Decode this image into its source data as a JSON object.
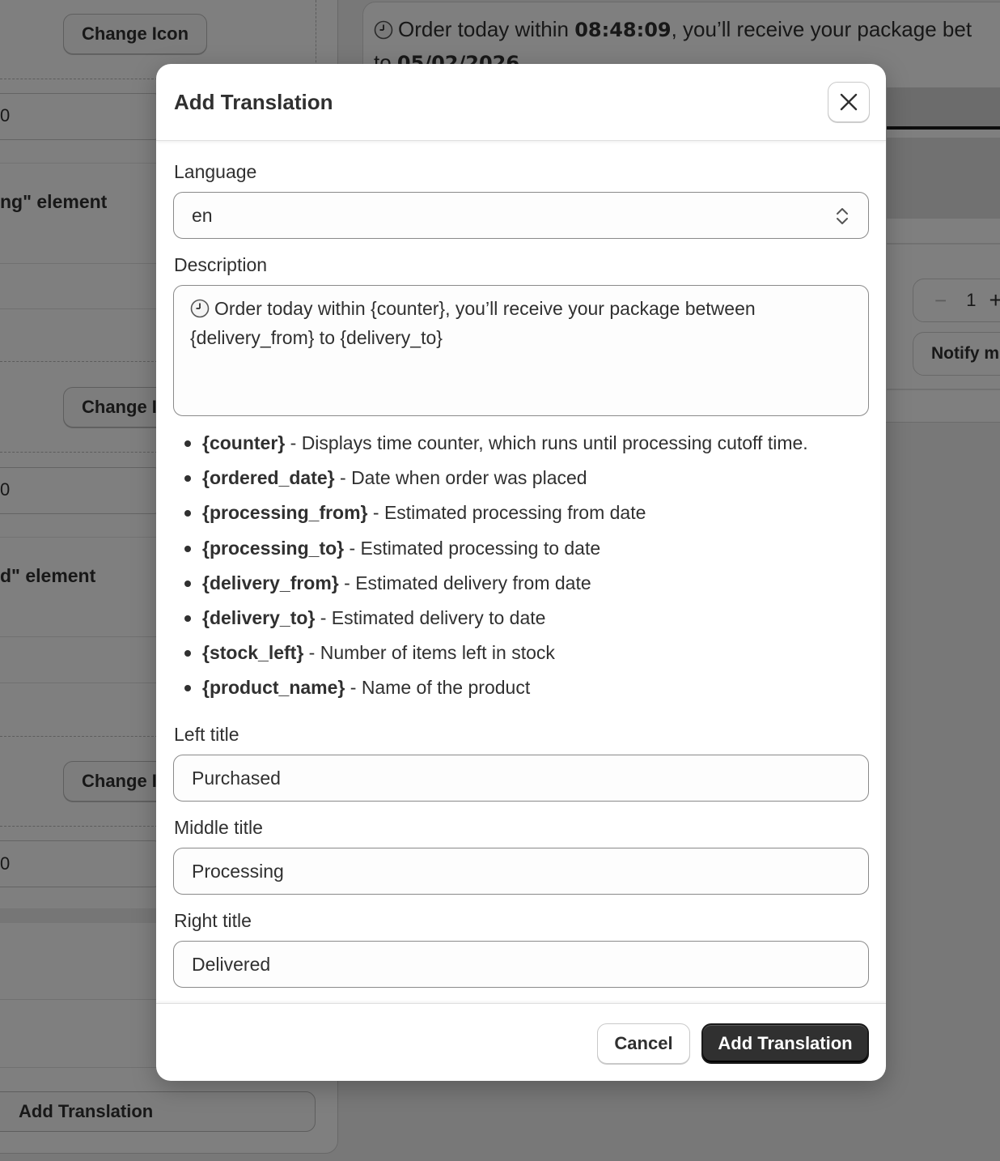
{
  "background": {
    "left_panel": {
      "change_icon_label": "Change Icon",
      "change_icon_partial": "Change I",
      "field_value": "0",
      "heading_1": "ng\" element",
      "heading_2": "d\" element",
      "add_translation_label": "Add Translation"
    },
    "preview": {
      "line_prefix": "Order today within ",
      "counter": "08:48:09",
      "line_middle": ", you’ll receive your package bet",
      "line2_prefix": "to ",
      "delivery_to": "05/02/2026",
      "quantity": "1",
      "notify_label": "Notify m"
    }
  },
  "modal": {
    "title": "Add Translation",
    "close_icon": "close-icon",
    "language": {
      "label": "Language",
      "value": "en"
    },
    "description": {
      "label": "Description",
      "value": "Order today within {counter}, you’ll receive your package between {delivery_from} to {delivery_to}"
    },
    "variables": [
      {
        "key": "{counter}",
        "desc": " - Displays time counter, which runs until processing cutoff time."
      },
      {
        "key": "{ordered_date}",
        "desc": " - Date when order was placed"
      },
      {
        "key": "{processing_from}",
        "desc": " - Estimated processing from date"
      },
      {
        "key": "{processing_to}",
        "desc": " - Estimated processing to date"
      },
      {
        "key": "{delivery_from}",
        "desc": " - Estimated delivery from date"
      },
      {
        "key": "{delivery_to}",
        "desc": " - Estimated delivery to date"
      },
      {
        "key": "{stock_left}",
        "desc": " - Number of items left in stock"
      },
      {
        "key": "{product_name}",
        "desc": " - Name of the product"
      }
    ],
    "left_title": {
      "label": "Left title",
      "value": "Purchased"
    },
    "middle_title": {
      "label": "Middle title",
      "value": "Processing"
    },
    "right_title": {
      "label": "Right title",
      "value": "Delivered"
    },
    "cancel_label": "Cancel",
    "submit_label": "Add Translation"
  },
  "colors": {
    "primary_button": "#303030",
    "overlay": "#000000",
    "text": "#303030"
  }
}
